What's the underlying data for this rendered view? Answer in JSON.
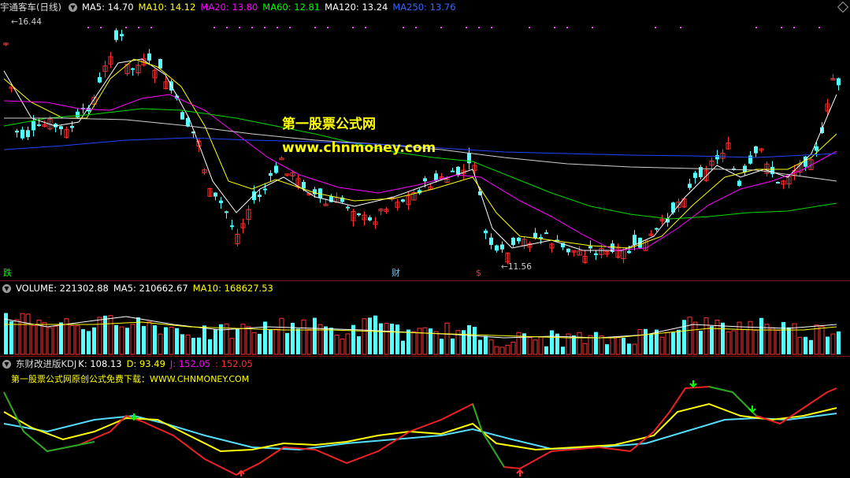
{
  "main": {
    "title": "宇通客车(日线)",
    "indicators": [
      {
        "label": "MA5: 14.70",
        "color": "#ffffff"
      },
      {
        "label": "MA10: 14.12",
        "color": "#ffff00"
      },
      {
        "label": "MA20: 13.80",
        "color": "#ff00ff"
      },
      {
        "label": "MA60: 12.81",
        "color": "#00ff00"
      },
      {
        "label": "MA120: 13.24",
        "color": "#ffffff"
      },
      {
        "label": "MA250: 13.76",
        "color": "#3366ff"
      }
    ],
    "high_label": "16.44",
    "low_label": "11.56",
    "watermark_1": "第一股票公式网",
    "watermark_2": "www.chnmoney.com",
    "events": [
      {
        "text": "跌",
        "color": "#00ff00"
      },
      {
        "text": "财",
        "color": "#66ccff"
      },
      {
        "text": "$",
        "color": "#ff3333"
      }
    ]
  },
  "volume": {
    "label": "VOLUME: 221302.88",
    "ma5": "MA5: 210662.67",
    "ma10": "MA10: 168627.53"
  },
  "kdj": {
    "name": "东财改进版KDJ",
    "k": "K: 108.13",
    "d": "D: 93.49",
    "j": "J: 152.05",
    "extra": ": 152.05",
    "note": "第一股票公式网原创公式免费下载：WWW.CHNMONEY.COM"
  },
  "colors": {
    "up": "#ff3232",
    "down": "#54ffff",
    "background": "#000000",
    "separator": "#7a1010"
  }
}
